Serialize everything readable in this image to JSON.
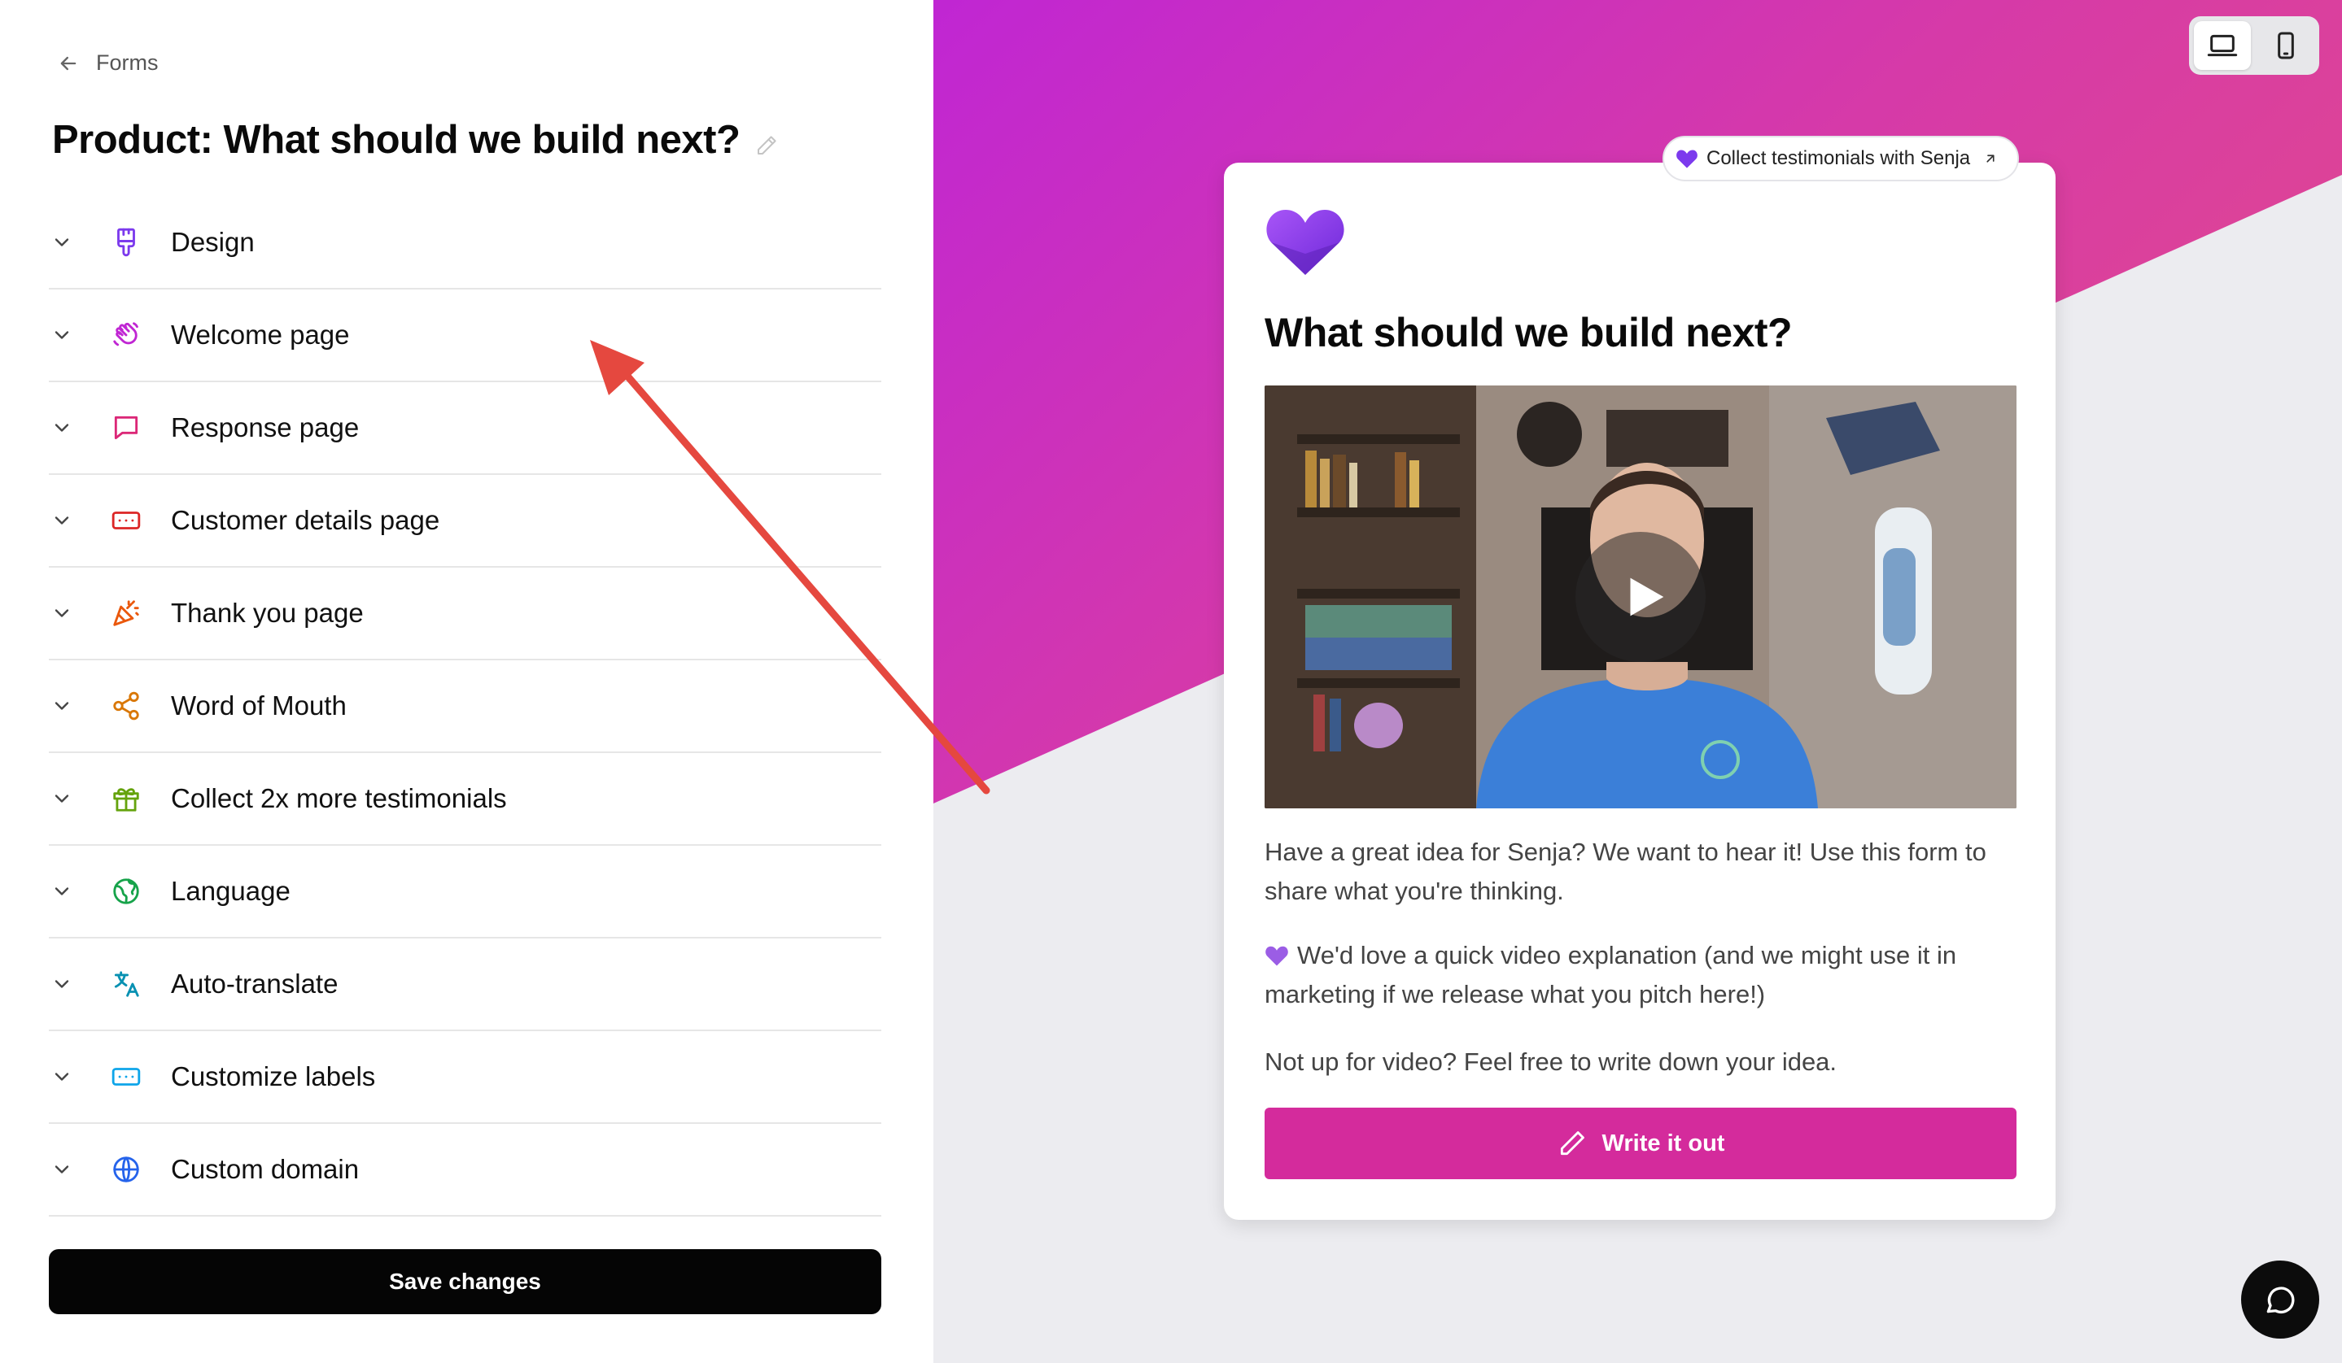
{
  "nav": {
    "back_label": "Forms"
  },
  "page": {
    "title": "Product: What should we build next?"
  },
  "sections": [
    {
      "label": "Design",
      "icon": "paint-brush-icon",
      "color": "#7c3aed"
    },
    {
      "label": "Welcome page",
      "icon": "waving-hand-icon",
      "color": "#c026d3"
    },
    {
      "label": "Response page",
      "icon": "chat-bubble-icon",
      "color": "#db2777"
    },
    {
      "label": "Customer details page",
      "icon": "id-card-icon",
      "color": "#dc2626"
    },
    {
      "label": "Thank you page",
      "icon": "party-popper-icon",
      "color": "#ea580c"
    },
    {
      "label": "Word of Mouth",
      "icon": "share-icon",
      "color": "#d97706"
    },
    {
      "label": "Collect 2x more testimonials",
      "icon": "gift-icon",
      "color": "#65a30d"
    },
    {
      "label": "Language",
      "icon": "globe-leaf-icon",
      "color": "#16a34a"
    },
    {
      "label": "Auto-translate",
      "icon": "translate-icon",
      "color": "#0891b2"
    },
    {
      "label": "Customize labels",
      "icon": "text-input-icon",
      "color": "#0ea5e9"
    },
    {
      "label": "Custom domain",
      "icon": "globe-icon",
      "color": "#2563eb"
    }
  ],
  "actions": {
    "save_label": "Save changes"
  },
  "preview": {
    "badge_label": "Collect testimonials with Senja",
    "form_title": "What should we build next?",
    "paragraph_1": "Have a great idea for Senja? We want to hear it! Use this form to share what you're thinking.",
    "paragraph_2": "We'd love a quick video explanation (and we might use it in marketing if we release what you pitch here!)",
    "paragraph_3": "Not up for video? Feel free to write down your idea.",
    "write_button_label": "Write it out",
    "accent_color": "#d42b9c",
    "brand_color": "#7c3aed"
  },
  "device_toggle": {
    "options": [
      "desktop-icon",
      "mobile-icon"
    ],
    "selected": "desktop-icon"
  }
}
